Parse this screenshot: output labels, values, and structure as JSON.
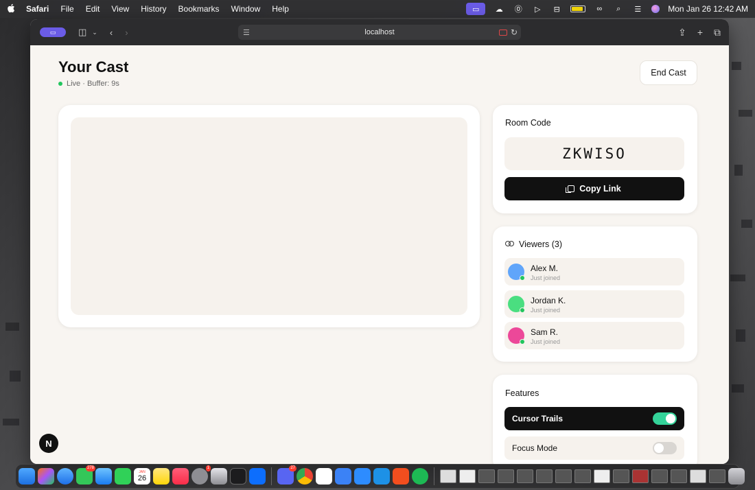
{
  "menubar": {
    "apple": "",
    "app_name": "Safari",
    "menus": [
      "File",
      "Edit",
      "View",
      "History",
      "Bookmarks",
      "Window",
      "Help"
    ],
    "clock": "Mon Jan 26  12:42 AM"
  },
  "browser": {
    "url": "localhost"
  },
  "page": {
    "title": "Your Cast",
    "status": "Live · Buffer: 9s",
    "end_cast_label": "End Cast"
  },
  "room": {
    "title": "Room Code",
    "code": "ZKWISO",
    "copy_label": "Copy Link"
  },
  "viewers": {
    "title": "Viewers (3)",
    "list": [
      {
        "name": "Alex M.",
        "status": "Just joined",
        "color": "#60a5fa"
      },
      {
        "name": "Jordan K.",
        "status": "Just joined",
        "color": "#4ade80"
      },
      {
        "name": "Sam R.",
        "status": "Just joined",
        "color": "#ec4899"
      }
    ]
  },
  "features": {
    "title": "Features",
    "items": [
      {
        "label": "Cursor Trails",
        "enabled": true
      },
      {
        "label": "Focus Mode",
        "enabled": false
      }
    ]
  },
  "next_badge": "N",
  "dock": {
    "calendar_day": "26",
    "calendar_month": "JAN",
    "messages_badge": "278",
    "settings_badge": "1",
    "discord_badge": "27"
  },
  "colors": {
    "accent": "#6b5ce7",
    "live": "#22c55e",
    "toggle_on": "#34d399"
  }
}
